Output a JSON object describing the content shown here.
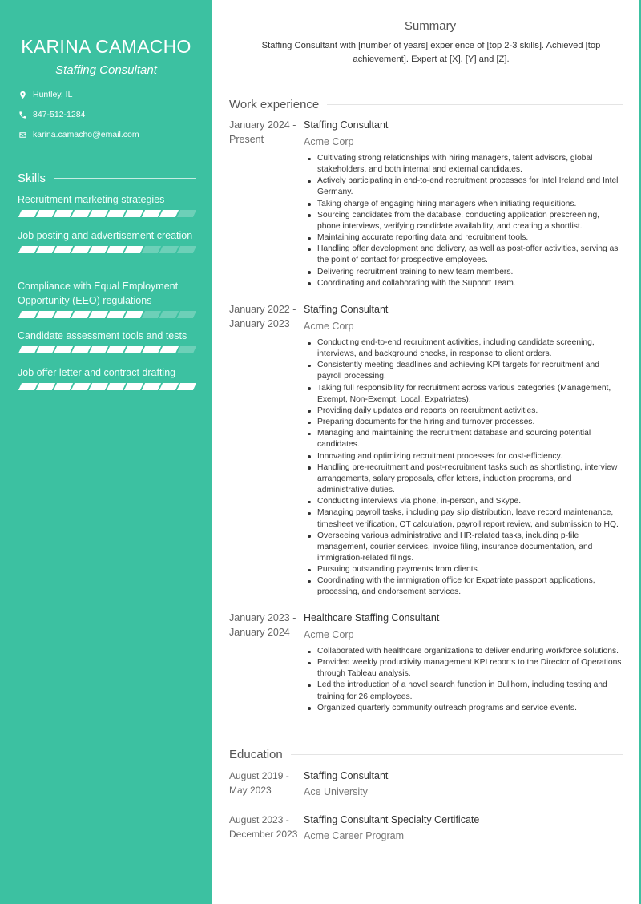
{
  "profile": {
    "name": "KARINA CAMACHO",
    "role": "Staffing Consultant",
    "location": "Huntley, IL",
    "phone": "847-512-1284",
    "email": "karina.camacho@email.com"
  },
  "colors": {
    "accent": "#3cc1a1"
  },
  "skills": {
    "heading": "Skills",
    "items": [
      {
        "label": "Recruitment marketing strategies",
        "level": 9,
        "max": 10
      },
      {
        "label": "Job posting and advertisement creation",
        "level": 7,
        "max": 10
      },
      {
        "label": "Compliance with Equal Employment Opportunity (EEO) regulations",
        "level": 7,
        "max": 10
      },
      {
        "label": "Candidate assessment tools and tests",
        "level": 9,
        "max": 10
      },
      {
        "label": "Job offer letter and contract drafting",
        "level": 10,
        "max": 10
      }
    ]
  },
  "summary": {
    "heading": "Summary",
    "text": "Staffing Consultant with [number of years] experience of [top 2-3 skills]. Achieved [top achievement]. Expert at [X], [Y] and [Z]."
  },
  "work": {
    "heading": "Work experience",
    "entries": [
      {
        "date_start": "January 2024 -",
        "date_end": "Present",
        "title": "Staffing Consultant",
        "org": "Acme Corp",
        "bullets": [
          "Cultivating strong relationships with hiring managers, talent advisors, global stakeholders, and both internal and external candidates.",
          "Actively participating in end-to-end recruitment processes for Intel Ireland and Intel Germany.",
          "Taking charge of engaging hiring managers when initiating requisitions.",
          "Sourcing candidates from the database, conducting application prescreening, phone interviews, verifying candidate availability, and creating a shortlist.",
          "Maintaining accurate reporting data and recruitment tools.",
          "Handling offer development and delivery, as well as post-offer activities, serving as the point of contact for prospective employees.",
          "Delivering recruitment training to new team members.",
          "Coordinating and collaborating with the Support Team."
        ]
      },
      {
        "date_start": "January 2022 -",
        "date_end": "January 2023",
        "title": "Staffing Consultant",
        "org": "Acme Corp",
        "bullets": [
          "Conducting end-to-end recruitment activities, including candidate screening, interviews, and background checks, in response to client orders.",
          "Consistently meeting deadlines and achieving KPI targets for recruitment and payroll processing.",
          "Taking full responsibility for recruitment across various categories (Management, Exempt, Non-Exempt, Local, Expatriates).",
          "Providing daily updates and reports on recruitment activities.",
          "Preparing documents for the hiring and turnover processes.",
          "Managing and maintaining the recruitment database and sourcing potential candidates.",
          "Innovating and optimizing recruitment processes for cost-efficiency.",
          "Handling pre-recruitment and post-recruitment tasks such as shortlisting, interview arrangements, salary proposals, offer letters, induction programs, and administrative duties.",
          "Conducting interviews via phone, in-person, and Skype.",
          "Managing payroll tasks, including pay slip distribution, leave record maintenance, timesheet verification, OT calculation, payroll report review, and submission to HQ.",
          "Overseeing various administrative and HR-related tasks, including p-file management, courier services, invoice filing, insurance documentation, and immigration-related filings.",
          "Pursuing outstanding payments from clients.",
          "Coordinating with the immigration office for Expatriate passport applications, processing, and endorsement services."
        ]
      },
      {
        "date_start": "January 2023 -",
        "date_end": "January 2024",
        "title": "Healthcare Staffing Consultant",
        "org": "Acme Corp",
        "bullets": [
          "Collaborated with healthcare organizations to deliver enduring workforce solutions.",
          "Provided weekly productivity management KPI reports to the Director of Operations through Tableau analysis.",
          "Led the introduction of a novel search function in Bullhorn, including testing and training for 26 employees.",
          "Organized quarterly community outreach programs and service events."
        ]
      }
    ]
  },
  "education": {
    "heading": "Education",
    "entries": [
      {
        "date_start": "August 2019 -",
        "date_end": "May 2023",
        "title": "Staffing Consultant",
        "org": "Ace University"
      },
      {
        "date_start": "August 2023 -",
        "date_end": "December 2023",
        "title": "Staffing Consultant Specialty Certificate",
        "org": "Acme Career Program"
      }
    ]
  }
}
